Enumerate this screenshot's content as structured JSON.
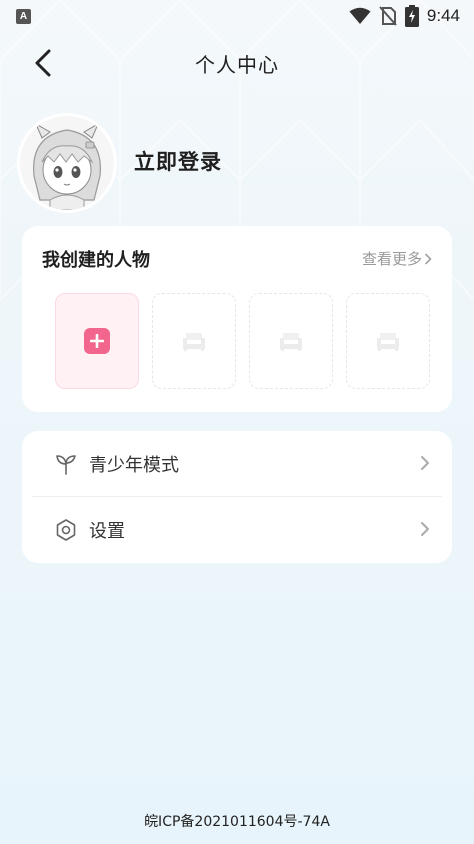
{
  "status_bar": {
    "app_icon_letter": "A",
    "time": "9:44",
    "icons": [
      "wifi-icon",
      "no-sim-icon",
      "battery-charging-icon"
    ]
  },
  "header": {
    "title": "个人中心",
    "back_icon": "chevron-left-icon"
  },
  "profile": {
    "login_text": "立即登录"
  },
  "created_characters": {
    "title": "我创建的人物",
    "see_more": "查看更多",
    "slots": [
      "add",
      "empty",
      "empty",
      "empty"
    ]
  },
  "menu": {
    "items": [
      {
        "label": "青少年模式",
        "icon": "sprout-icon"
      },
      {
        "label": "设置",
        "icon": "settings-hexagon-icon"
      }
    ]
  },
  "footer": {
    "icp": "皖ICP备2021011604号-74A"
  },
  "colors": {
    "accent_pink": "#f2668d",
    "add_slot_bg": "#fff1f4",
    "background": "#eef6fa"
  }
}
